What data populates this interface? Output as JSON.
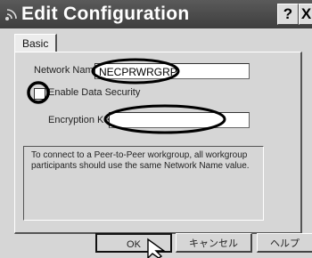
{
  "window": {
    "title": "Edit Configuration",
    "help_label": "?",
    "close_label": "X"
  },
  "tabs": [
    {
      "label": "Basic"
    }
  ],
  "form": {
    "network_name": {
      "label": "Network Name",
      "value": "NECPRWRGRP",
      "access_key": "N"
    },
    "data_security": {
      "label": "Enable Data Security",
      "checked": false,
      "access_key": "E"
    },
    "encryption_key": {
      "label": "Encryption Key",
      "value": "",
      "access_key": "E"
    },
    "note": "To connect to a Peer-to-Peer workgroup, all workgroup participants should use the same Network Name value."
  },
  "buttons": {
    "ok": "OK",
    "cancel": "キャンセル",
    "help": "ヘルプ"
  },
  "annotations": {
    "highlight_color": "#000000"
  },
  "colors": {
    "titlebar": "#444444",
    "dialog": "#d6d6d6"
  }
}
